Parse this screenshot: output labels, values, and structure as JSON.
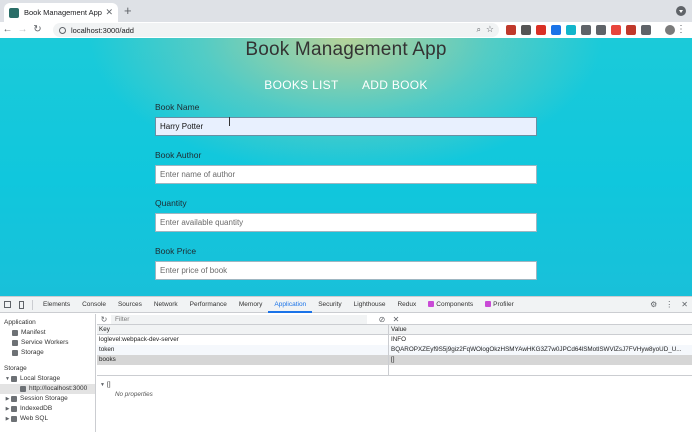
{
  "browser": {
    "tab_title": "Book Management App",
    "tab_close": "✕",
    "new_tab": "+",
    "url": "localhost:3000/add",
    "nav": {
      "back": "←",
      "forward": "→",
      "reload": "↻"
    },
    "icons": {
      "zoom": "⌕",
      "star": "☆",
      "menu": "⋮"
    },
    "extensions": [
      "#c0392b",
      "#555555",
      "#d93025",
      "#1a73e8",
      "#12b5cb",
      "#5f6368",
      "#5f6368",
      "#e8453c",
      "#c0392b",
      "#5f6368"
    ]
  },
  "page": {
    "title": "Book Management App",
    "nav": {
      "books_list": "BOOKS LIST",
      "add_book": "ADD BOOK"
    },
    "form": {
      "book_name": {
        "label": "Book Name",
        "value": "Harry Potter",
        "placeholder": ""
      },
      "book_author": {
        "label": "Book Author",
        "value": "",
        "placeholder": "Enter name of author"
      },
      "quantity": {
        "label": "Quantity",
        "value": "",
        "placeholder": "Enter available quantity"
      },
      "book_price": {
        "label": "Book Price",
        "value": "",
        "placeholder": "Enter price of book"
      }
    }
  },
  "devtools": {
    "tabs": [
      "Elements",
      "Console",
      "Sources",
      "Network",
      "Performance",
      "Memory",
      "Application",
      "Security",
      "Lighthouse",
      "Redux",
      "Components",
      "Profiler"
    ],
    "active_tab": "Application",
    "right_icons": {
      "settings": "⚙",
      "more": "⋮",
      "close": "✕"
    },
    "sidebar": {
      "application_head": "Application",
      "application_items": [
        "Manifest",
        "Service Workers",
        "Storage"
      ],
      "storage_head": "Storage",
      "local_storage": "Local Storage",
      "local_origin": "http://localhost:3000",
      "session_storage": "Session Storage",
      "indexeddb": "IndexedDB",
      "websql": "Web SQL"
    },
    "filter": {
      "placeholder": "Filter",
      "refresh": "↻",
      "clear": "⊘",
      "delete": "✕"
    },
    "grid": {
      "key_header": "Key",
      "value_header": "Value",
      "rows": [
        {
          "key": "loglevel:webpack-dev-server",
          "value": "INFO"
        },
        {
          "key": "token",
          "value": "BQAROPXZEyf9S5j9giz2FqWOlogOkzHSMYAwHKG3Z7w0JPCd64lSMotlSWVlZsJ7FVHyw8yoUD_U..."
        },
        {
          "key": "books",
          "value": "[]"
        }
      ]
    },
    "preview": {
      "root": "[]",
      "empty": "No properties"
    }
  }
}
